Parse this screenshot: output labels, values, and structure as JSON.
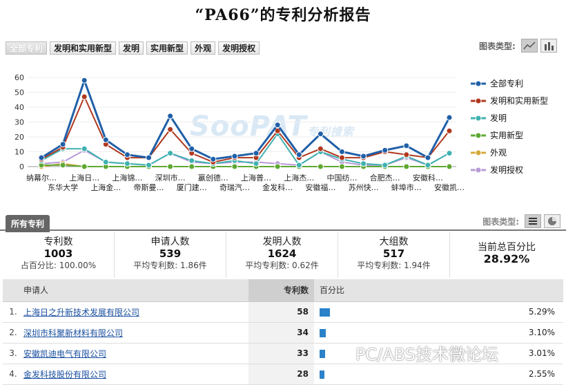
{
  "title": "“PA66”的专利分析报告",
  "tabs": [
    {
      "label": "全部专利",
      "active": true
    },
    {
      "label": "发明和实用新型"
    },
    {
      "label": "发明"
    },
    {
      "label": "实用新型"
    },
    {
      "label": "外观"
    },
    {
      "label": "发明授权"
    }
  ],
  "chart_type_label": "图表类型:",
  "watermark": {
    "main": "SooPAT",
    "sub": "专利搜索"
  },
  "chart_data": {
    "type": "line",
    "ylim": [
      0,
      60
    ],
    "yticks": [
      0,
      10,
      20,
      30,
      40,
      50,
      60
    ],
    "categories": [
      "纳幕尔…",
      "东华大学",
      "上海日…",
      "上海金…",
      "上海锦…",
      "帝斯曼…",
      "深圳市…",
      "厦门建…",
      "嬴创德…",
      "奇瑞汽…",
      "上海普…",
      "金发科…",
      "上海杰…",
      "安徽福…",
      "中国纺…",
      "苏州快…",
      "合肥杰…",
      "蚌埠市…",
      "安徽科…",
      "安徽凯…"
    ],
    "series": [
      {
        "name": "全部专利",
        "color": "#1f5fa8",
        "values": [
          6,
          15,
          58,
          18,
          8,
          6,
          34,
          12,
          5,
          7,
          9,
          28,
          8,
          22,
          10,
          7,
          11,
          14,
          6,
          33
        ]
      },
      {
        "name": "发明和实用新型",
        "color": "#b0381e",
        "values": [
          5,
          13,
          47,
          15,
          6,
          6,
          25,
          9,
          3,
          6,
          6,
          24,
          6,
          12,
          6,
          6,
          10,
          8,
          6,
          24
        ]
      },
      {
        "name": "发明",
        "color": "#3fb1b0",
        "values": [
          4,
          12,
          12,
          3,
          2,
          1,
          9,
          4,
          2,
          4,
          2,
          22,
          1,
          10,
          5,
          2,
          1,
          7,
          1,
          9
        ]
      },
      {
        "name": "实用新型",
        "color": "#5ea832",
        "values": [
          1,
          1,
          0,
          0,
          0,
          0,
          0,
          0,
          0,
          0,
          0,
          0,
          0,
          0,
          0,
          0,
          0,
          0,
          0,
          0
        ]
      },
      {
        "name": "外观",
        "color": "#d4a83c",
        "values": [
          0,
          2,
          0,
          0,
          0,
          0,
          0,
          0,
          0,
          0,
          0,
          0,
          0,
          0,
          0,
          0,
          0,
          0,
          0,
          0
        ]
      },
      {
        "name": "发明授权",
        "color": "#b79ad8",
        "values": [
          2,
          3,
          11,
          3,
          2,
          1,
          9,
          3,
          2,
          3,
          3,
          2,
          1,
          10,
          3,
          1,
          1,
          6,
          1,
          9
        ]
      }
    ]
  },
  "section": {
    "tab": "所有专利",
    "chart_type_label": "图表类型:"
  },
  "stats": [
    {
      "head": "专利数",
      "value": "1003",
      "sub": "占百分比:  100.00%"
    },
    {
      "head": "申请人数",
      "value": "539",
      "sub": "平均专利数:  1.86件"
    },
    {
      "head": "发明人数",
      "value": "1624",
      "sub": "平均专利数:  0.62件"
    },
    {
      "head": "大组数",
      "value": "517",
      "sub": "平均专利数:  1.94件"
    },
    {
      "head": "当前总百分比",
      "value": "28.92%"
    }
  ],
  "table": {
    "headers": {
      "applicant": "申请人",
      "count": "专利数",
      "percent": "百分比"
    },
    "rows": [
      {
        "idx": "1.",
        "name": "上海日之升新技术发展有限公司",
        "count": "58",
        "pct": "5.29%",
        "pct_value": 5.29
      },
      {
        "idx": "2.",
        "name": "深圳市科聚新材料有限公司",
        "count": "34",
        "pct": "3.10%",
        "pct_value": 3.1
      },
      {
        "idx": "3.",
        "name": "安徽凯迪电气有限公司",
        "count": "33",
        "pct": "3.01%",
        "pct_value": 3.01
      },
      {
        "idx": "4.",
        "name": "金发科技股份有限公司",
        "count": "28",
        "pct": "2.55%",
        "pct_value": 2.55
      }
    ]
  },
  "footer_watermark": "PC/ABS技术微论坛"
}
